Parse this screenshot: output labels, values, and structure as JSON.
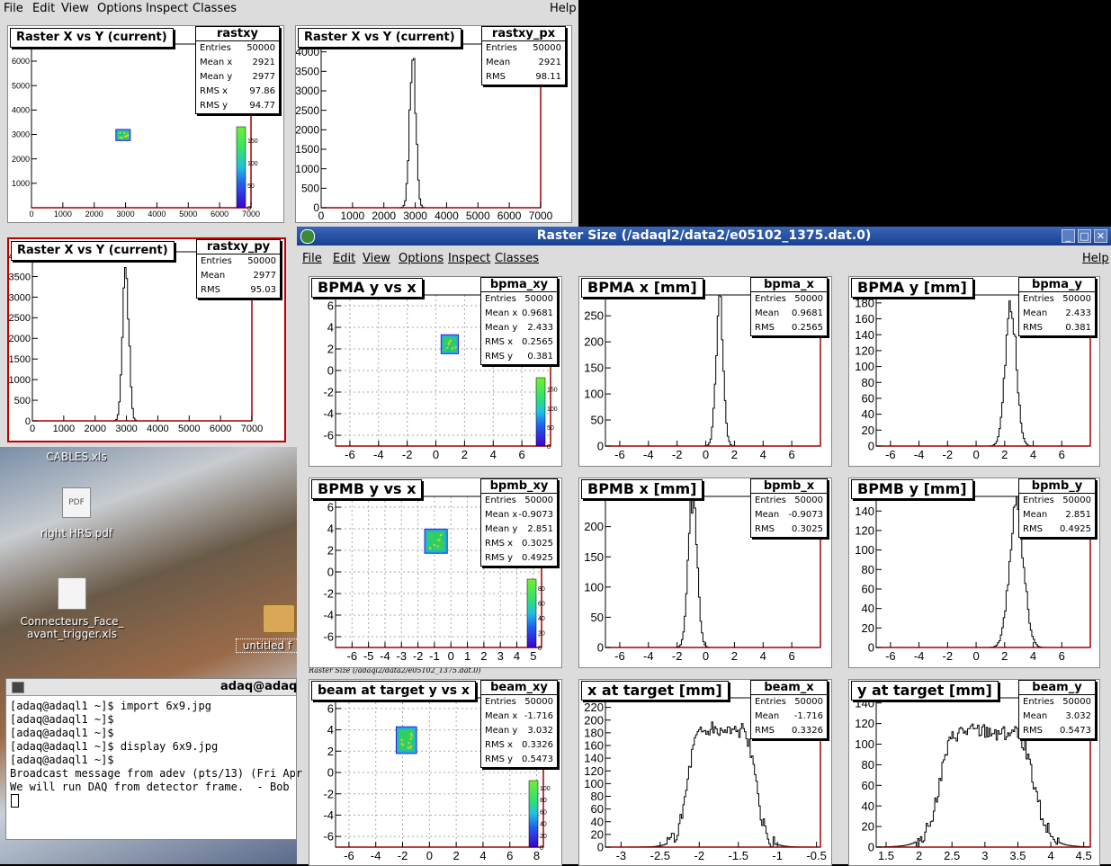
{
  "desktop": {
    "icons": [
      {
        "label": "CABLES.xls"
      },
      {
        "label": "right HRS.pdf"
      },
      {
        "label": "Connecteurs_Face_\navant_trigger.xls"
      },
      {
        "label": "untitled f"
      }
    ]
  },
  "back_window": {
    "menu": {
      "file": "File",
      "edit": "Edit",
      "view": "View",
      "options": "Options",
      "inspect": "Inspect",
      "classes": "Classes",
      "help": "Help"
    },
    "pads": [
      {
        "title": "Raster X vs Y (current)",
        "stats_name": "rastxy",
        "stats": [
          [
            "Entries",
            "50000"
          ],
          [
            "Mean x",
            "2921"
          ],
          [
            "Mean y",
            "2977"
          ],
          [
            "RMS x",
            "97.86"
          ],
          [
            "RMS y",
            "94.77"
          ]
        ]
      },
      {
        "title": "Raster X vs Y (current)",
        "stats_name": "rastxy_px",
        "stats": [
          [
            "Entries",
            "50000"
          ],
          [
            "Mean",
            "2921"
          ],
          [
            "RMS",
            "98.11"
          ]
        ]
      },
      {
        "title": "Raster X vs Y (current)",
        "stats_name": "rastxy_py",
        "stats": [
          [
            "Entries",
            "50000"
          ],
          [
            "Mean",
            "2977"
          ],
          [
            "RMS",
            "95.03"
          ]
        ]
      }
    ]
  },
  "main_window": {
    "title": "Raster Size (/adaql2/data2/e05102_1375.dat.0)",
    "menu": {
      "file": "File",
      "edit": "Edit",
      "view": "View",
      "options": "Options",
      "inspect": "Inspect",
      "classes": "Classes",
      "help": "Help"
    },
    "canvas_label": "Raster Size (/adaql2/data2/e05102_1375.dat.0)",
    "pads": [
      {
        "title": "BPMA y vs x",
        "stats_name": "bpma_xy",
        "stats": [
          [
            "Entries",
            "50000"
          ],
          [
            "Mean x",
            "0.9681"
          ],
          [
            "Mean y",
            "2.433"
          ],
          [
            "RMS x",
            "0.2565"
          ],
          [
            "RMS y",
            "0.381"
          ]
        ]
      },
      {
        "title": "BPMA x [mm]",
        "stats_name": "bpma_x",
        "stats": [
          [
            "Entries",
            "50000"
          ],
          [
            "Mean",
            "0.9681"
          ],
          [
            "RMS",
            "0.2565"
          ]
        ]
      },
      {
        "title": "BPMA y [mm]",
        "stats_name": "bpma_y",
        "stats": [
          [
            "Entries",
            "50000"
          ],
          [
            "Mean",
            "2.433"
          ],
          [
            "RMS",
            "0.381"
          ]
        ]
      },
      {
        "title": "BPMB y vs x",
        "stats_name": "bpmb_xy",
        "stats": [
          [
            "Entries",
            "50000"
          ],
          [
            "Mean x",
            "-0.9073"
          ],
          [
            "Mean y",
            "2.851"
          ],
          [
            "RMS x",
            "0.3025"
          ],
          [
            "RMS y",
            "0.4925"
          ]
        ]
      },
      {
        "title": "BPMB x [mm]",
        "stats_name": "bpmb_x",
        "stats": [
          [
            "Entries",
            "50000"
          ],
          [
            "Mean",
            "-0.9073"
          ],
          [
            "RMS",
            "0.3025"
          ]
        ]
      },
      {
        "title": "BPMB y [mm]",
        "stats_name": "bpmb_y",
        "stats": [
          [
            "Entries",
            "50000"
          ],
          [
            "Mean",
            "2.851"
          ],
          [
            "RMS",
            "0.4925"
          ]
        ]
      },
      {
        "title": "beam at target y vs x",
        "stats_name": "beam_xy",
        "stats": [
          [
            "Entries",
            "50000"
          ],
          [
            "Mean x",
            "-1.716"
          ],
          [
            "Mean y",
            "3.032"
          ],
          [
            "RMS x",
            "0.3326"
          ],
          [
            "RMS y",
            "0.5473"
          ]
        ]
      },
      {
        "title": "x at target [mm]",
        "stats_name": "beam_x",
        "stats": [
          [
            "Entries",
            "50000"
          ],
          [
            "Mean",
            "-1.716"
          ],
          [
            "RMS",
            "0.3326"
          ]
        ]
      },
      {
        "title": "y at target [mm]",
        "stats_name": "beam_y",
        "stats": [
          [
            "Entries",
            "50000"
          ],
          [
            "Mean",
            "3.032"
          ],
          [
            "RMS",
            "0.5473"
          ]
        ]
      }
    ]
  },
  "terminal": {
    "title": "adaq@adaq",
    "lines": [
      "[adaq@adaql1 ~]$ import 6x9.jpg",
      "[adaq@adaql1 ~]$",
      "[adaq@adaql1 ~]$",
      "[adaq@adaql1 ~]$ display 6x9.jpg",
      "[adaq@adaql1 ~]$",
      "Broadcast message from adev (pts/13) (Fri Apr",
      "",
      "We will run DAQ from detector frame.  - Bob"
    ]
  },
  "chart_data": [
    {
      "type": "heatmap",
      "name": "rastxy",
      "xticks": [
        "0",
        "1000",
        "2000",
        "3000",
        "4000",
        "5000",
        "6000",
        "7000"
      ],
      "yticks": [
        "1000",
        "2000",
        "3000",
        "4000",
        "5000",
        "6000"
      ],
      "xlim": [
        0,
        7000
      ],
      "ylim": [
        0,
        6700
      ],
      "colorbar": [
        "0",
        "50",
        "100",
        "150"
      ],
      "spots": [
        {
          "x": 2921,
          "y": 2977,
          "sx": 98,
          "sy": 95
        }
      ]
    },
    {
      "type": "line",
      "name": "rastxy_px",
      "xticks": [
        "0",
        "1000",
        "2000",
        "3000",
        "4000",
        "5000",
        "6000",
        "7000"
      ],
      "yticks": [
        "0",
        "500",
        "1000",
        "1500",
        "2000",
        "2500",
        "3000",
        "3500",
        "4000"
      ],
      "xlim": [
        0,
        7000
      ],
      "ylim": [
        0,
        4200
      ],
      "center": 2921,
      "sigma": 98,
      "peak": 3800
    },
    {
      "type": "line",
      "name": "rastxy_py",
      "xticks": [
        "0",
        "1000",
        "2000",
        "3000",
        "4000",
        "5000",
        "6000",
        "7000"
      ],
      "yticks": [
        "0",
        "500",
        "1000",
        "1500",
        "2000",
        "2500",
        "3000",
        "3500",
        "4000"
      ],
      "xlim": [
        0,
        7000
      ],
      "ylim": [
        0,
        4100
      ],
      "center": 2977,
      "sigma": 95,
      "peak": 3900
    },
    {
      "type": "heatmap",
      "name": "bpma_xy",
      "xticks": [
        "-6",
        "-4",
        "-2",
        "0",
        "2",
        "4",
        "6"
      ],
      "yticks": [
        "-6",
        "-4",
        "-2",
        "0",
        "2",
        "4",
        "6"
      ],
      "xlim": [
        -7,
        8
      ],
      "ylim": [
        -7,
        7
      ],
      "colorbar": [
        "0",
        "50",
        "100",
        "150"
      ],
      "spots": [
        {
          "x": 0.9681,
          "y": 2.433,
          "sx": 0.26,
          "sy": 0.38
        }
      ]
    },
    {
      "type": "line",
      "name": "bpma_x",
      "xticks": [
        "-6",
        "-4",
        "-2",
        "0",
        "2",
        "4",
        "6"
      ],
      "yticks": [
        "0",
        "50",
        "100",
        "150",
        "200",
        "250"
      ],
      "xlim": [
        -7,
        8
      ],
      "ylim": [
        0,
        290
      ],
      "center": 0.9681,
      "sigma": 0.2565,
      "peak": 270
    },
    {
      "type": "line",
      "name": "bpma_y",
      "xticks": [
        "-6",
        "-4",
        "-2",
        "0",
        "2",
        "4",
        "6"
      ],
      "yticks": [
        "0",
        "20",
        "40",
        "60",
        "80",
        "100",
        "120",
        "140",
        "160",
        "180"
      ],
      "xlim": [
        -7,
        8
      ],
      "ylim": [
        0,
        190
      ],
      "center": 2.433,
      "sigma": 0.381,
      "peak": 180
    },
    {
      "type": "heatmap",
      "name": "bpmb_xy",
      "xticks": [
        "-6",
        "-5",
        "-4",
        "-3",
        "-2",
        "-1",
        "0",
        "1",
        "2",
        "3",
        "4",
        "5"
      ],
      "yticks": [
        "-6",
        "-4",
        "-2",
        "0",
        "2",
        "4",
        "6"
      ],
      "xlim": [
        -7,
        5.5
      ],
      "ylim": [
        -7,
        7
      ],
      "colorbar": [
        "0",
        "20",
        "40",
        "60",
        "80"
      ],
      "spots": [
        {
          "x": -0.9073,
          "y": 2.851,
          "sx": 0.3,
          "sy": 0.49
        }
      ]
    },
    {
      "type": "line",
      "name": "bpmb_x",
      "xticks": [
        "-6",
        "-4",
        "-2",
        "0",
        "2",
        "4",
        "6"
      ],
      "yticks": [
        "0",
        "50",
        "100",
        "150",
        "200",
        "250"
      ],
      "xlim": [
        -7,
        8
      ],
      "ylim": [
        0,
        250
      ],
      "center": -0.9073,
      "sigma": 0.3025,
      "peak": 245
    },
    {
      "type": "line",
      "name": "bpmb_y",
      "xticks": [
        "-6",
        "-4",
        "-2",
        "0",
        "2",
        "4",
        "6"
      ],
      "yticks": [
        "0",
        "20",
        "40",
        "60",
        "80",
        "100",
        "120",
        "140"
      ],
      "xlim": [
        -7,
        8
      ],
      "ylim": [
        0,
        155
      ],
      "center": 2.851,
      "sigma": 0.4925,
      "peak": 145
    },
    {
      "type": "heatmap",
      "name": "beam_xy",
      "xticks": [
        "-6",
        "-4",
        "-2",
        "0",
        "2",
        "4",
        "6",
        "8"
      ],
      "yticks": [
        "-6",
        "-4",
        "-2",
        "0",
        "2",
        "4",
        "6"
      ],
      "xlim": [
        -7,
        8.5
      ],
      "ylim": [
        -7,
        7
      ],
      "colorbar": [
        "0",
        "20",
        "40",
        "60",
        "80",
        "100"
      ],
      "spots": [
        {
          "x": -1.716,
          "y": 3.032,
          "sx": 0.33,
          "sy": 0.55
        }
      ]
    },
    {
      "type": "line",
      "name": "beam_x",
      "xticks": [
        "-3",
        "-2.5",
        "-2",
        "-1.5",
        "-1",
        "-0.5"
      ],
      "yticks": [
        "0",
        "20",
        "40",
        "60",
        "80",
        "100",
        "120",
        "140",
        "160",
        "180",
        "200",
        "220"
      ],
      "xlim": [
        -3.2,
        -0.45
      ],
      "ylim": [
        0,
        235
      ],
      "center": -1.716,
      "sigma": 0.3326,
      "peak": 215,
      "flat": true
    },
    {
      "type": "line",
      "name": "beam_y",
      "xticks": [
        "1.5",
        "2",
        "2.5",
        "3",
        "3.5",
        "4",
        "4.5"
      ],
      "yticks": [
        "0",
        "20",
        "40",
        "60",
        "80",
        "100",
        "120",
        "140"
      ],
      "xlim": [
        1.35,
        4.6
      ],
      "ylim": [
        0,
        145
      ],
      "center": 3.032,
      "sigma": 0.5473,
      "peak": 130,
      "flat": true
    }
  ]
}
